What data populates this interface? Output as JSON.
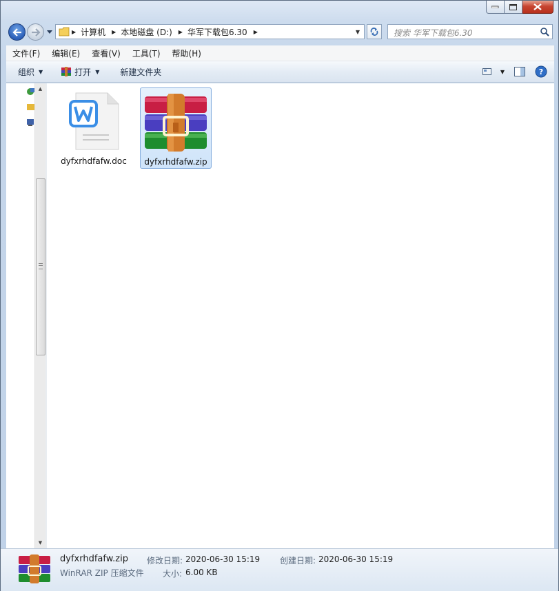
{
  "address": {
    "crumbs": [
      "计算机",
      "本地磁盘 (D:)",
      "华军下载包6.30"
    ]
  },
  "search": {
    "placeholder": "搜索 华军下载包6.30"
  },
  "menu": [
    "文件(F)",
    "编辑(E)",
    "查看(V)",
    "工具(T)",
    "帮助(H)"
  ],
  "toolbar": {
    "organize": "组织",
    "open": "打开",
    "new_folder": "新建文件夹"
  },
  "files": [
    {
      "name": "dyfxrhdfafw.doc",
      "icon": "word-document-icon",
      "selected": false
    },
    {
      "name": "dyfxrhdfafw.zip",
      "icon": "winrar-archive-icon",
      "selected": true
    }
  ],
  "details": {
    "name": "dyfxrhdfafw.zip",
    "type": "WinRAR ZIP 压缩文件",
    "modified_label": "修改日期:",
    "modified_value": "2020-06-30 15:19",
    "created_label": "创建日期:",
    "created_value": "2020-06-30 15:19",
    "size_label": "大小:",
    "size_value": "6.00 KB"
  },
  "colors": {
    "selection": "#cfe4fa",
    "word_blue": "#3a8ee6",
    "chrome": "#c5d6ea"
  }
}
